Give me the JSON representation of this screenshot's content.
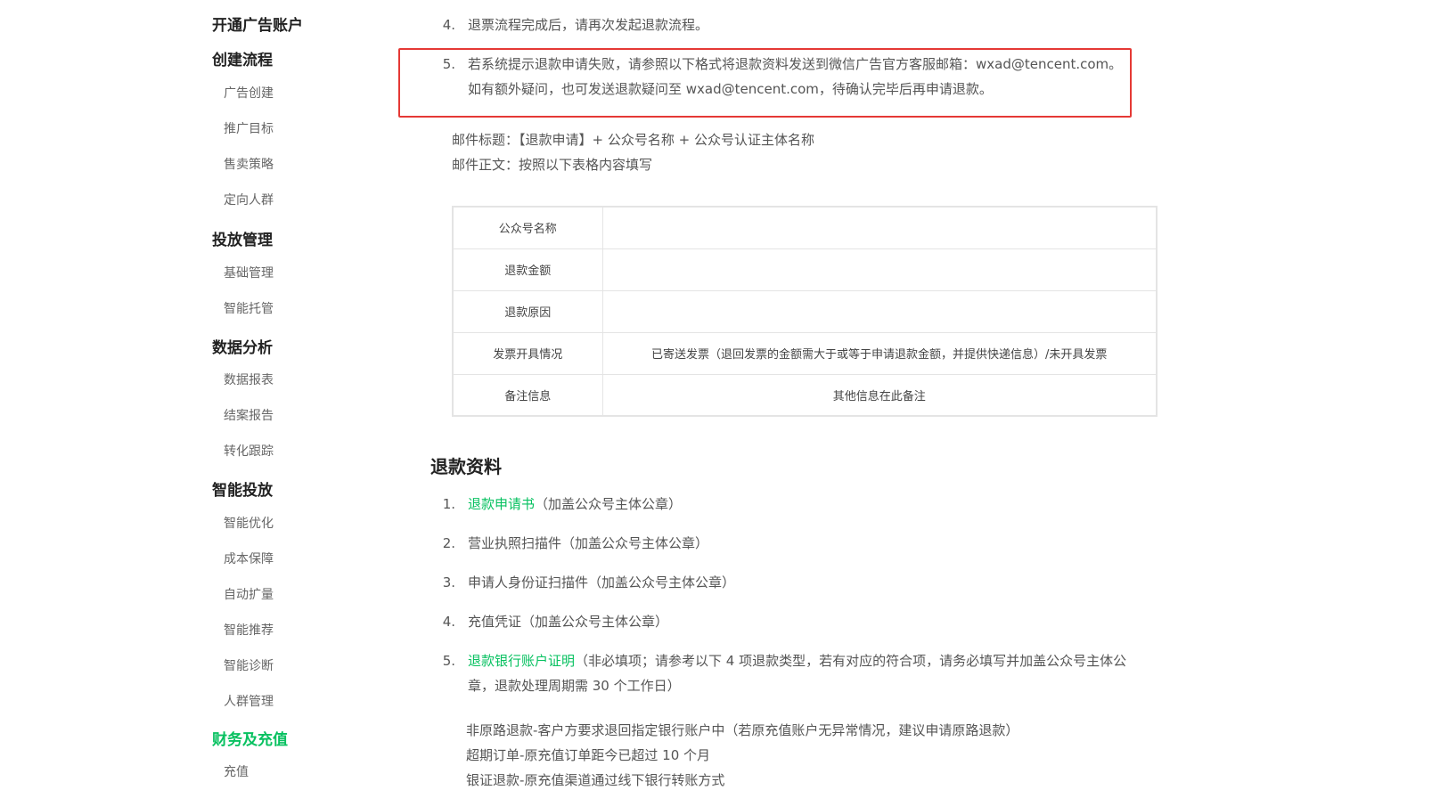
{
  "sidebar": {
    "sections": [
      {
        "label": "开通广告账户",
        "items": []
      },
      {
        "label": "创建流程",
        "items": [
          "广告创建",
          "推广目标",
          "售卖策略",
          "定向人群"
        ]
      },
      {
        "label": "投放管理",
        "items": [
          "基础管理",
          "智能托管"
        ]
      },
      {
        "label": "数据分析",
        "items": [
          "数据报表",
          "结案报告",
          "转化跟踪"
        ]
      },
      {
        "label": "智能投放",
        "items": [
          "智能优化",
          "成本保障",
          "自动扩量",
          "智能推荐",
          "智能诊断",
          "人群管理"
        ]
      },
      {
        "label": "财务及充值",
        "items": [
          "充值"
        ]
      }
    ]
  },
  "process_steps": [
    {
      "num": "4.",
      "text": "退票流程完成后，请再次发起退款流程。"
    },
    {
      "num": "5.",
      "line1": "若系统提示退款申请失败，请参照以下格式将退款资料发送到微信广告官方客服邮箱：wxad@tencent.com。",
      "line2": "如有额外疑问，也可发送退款疑问至 wxad@tencent.com，待确认完毕后再申请退款。"
    }
  ],
  "mail": {
    "subject": "邮件标题：【退款申请】+ 公众号名称 + 公众号认证主体名称",
    "body": "邮件正文：按照以下表格内容填写"
  },
  "table": {
    "rows": [
      {
        "label": "公众号名称",
        "value": ""
      },
      {
        "label": "退款金额",
        "value": ""
      },
      {
        "label": "退款原因",
        "value": ""
      },
      {
        "label": "发票开具情况",
        "value": "已寄送发票（退回发票的金额需大于或等于申请退款金额，并提供快递信息）/未开具发票"
      },
      {
        "label": "备注信息",
        "value": "其他信息在此备注"
      }
    ]
  },
  "refund_docs": {
    "title": "退款资料",
    "items": [
      {
        "num": "1.",
        "link": "退款申请书",
        "text": "（加盖公众号主体公章）"
      },
      {
        "num": "2.",
        "link": "",
        "text": "营业执照扫描件（加盖公众号主体公章）"
      },
      {
        "num": "3.",
        "link": "",
        "text": "申请人身份证扫描件（加盖公众号主体公章）"
      },
      {
        "num": "4.",
        "link": "",
        "text": "充值凭证（加盖公众号主体公章）"
      },
      {
        "num": "5.",
        "link": "退款银行账户证明",
        "text": "（非必填项；请参考以下 4 项退款类型，若有对应的符合项，请务必填写并加盖公众号主体公章，退款处理周期需 30 个工作日）"
      }
    ],
    "types": [
      "非原路退款-客户方要求退回指定银行账户中（若原充值账户无异常情况，建议申请原路退款）",
      "超期订单-原充值订单距今已超过 10 个月",
      "银证退款-原充值渠道通过线下银行转账方式"
    ]
  }
}
